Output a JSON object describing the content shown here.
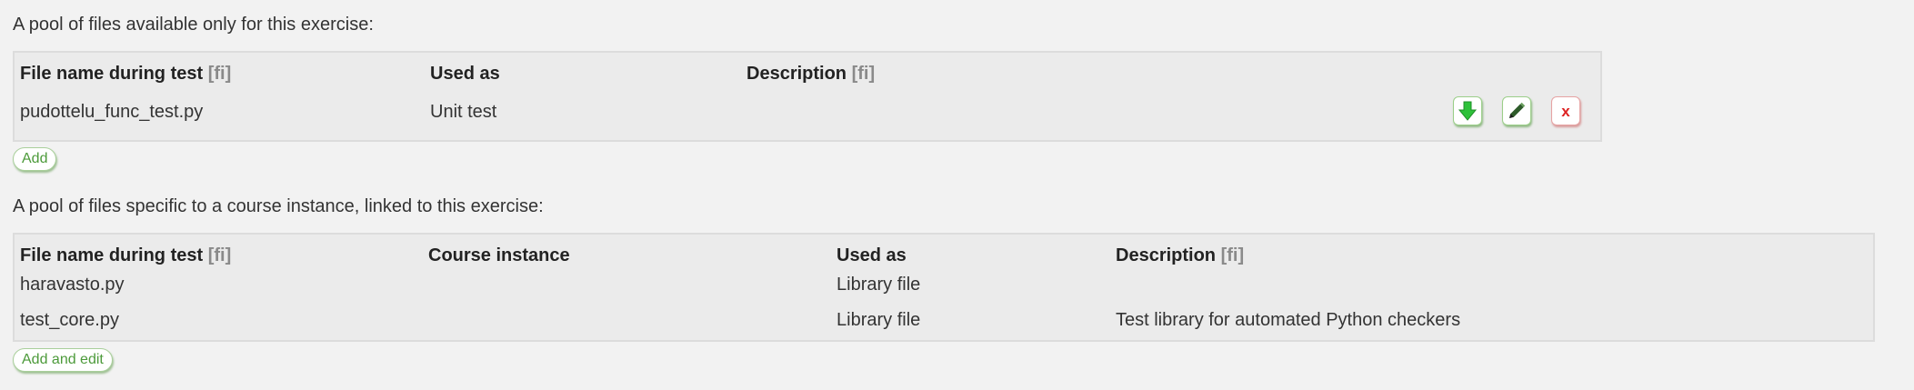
{
  "lang_tag": "[fi]",
  "exercise_pool": {
    "intro": "A pool of files available only for this exercise:",
    "headers": {
      "file_name": "File name during test",
      "used_as": "Used as",
      "description": "Description"
    },
    "rows": [
      {
        "file_name": "pudottelu_func_test.py",
        "used_as": "Unit test",
        "description": ""
      }
    ],
    "row_icons": [
      "download-icon",
      "edit-pencil-icon",
      "delete-x-icon"
    ],
    "add_label": "Add"
  },
  "instance_pool": {
    "intro": "A pool of files specific to a course instance, linked to this exercise:",
    "headers": {
      "file_name": "File name during test",
      "course_instance": "Course instance",
      "used_as": "Used as",
      "description": "Description"
    },
    "rows": [
      {
        "file_name": "haravasto.py",
        "course_instance": "",
        "used_as": "Library file",
        "description": ""
      },
      {
        "file_name": "test_core.py",
        "course_instance": "",
        "used_as": "Library file",
        "description": "Test library for automated Python checkers"
      }
    ],
    "add_label": "Add and edit"
  },
  "colors": {
    "page_bg": "#f2f2f2",
    "table_bg": "#ebebeb",
    "accent_green": "#4c9a3a",
    "delete_red": "#dd2222"
  }
}
